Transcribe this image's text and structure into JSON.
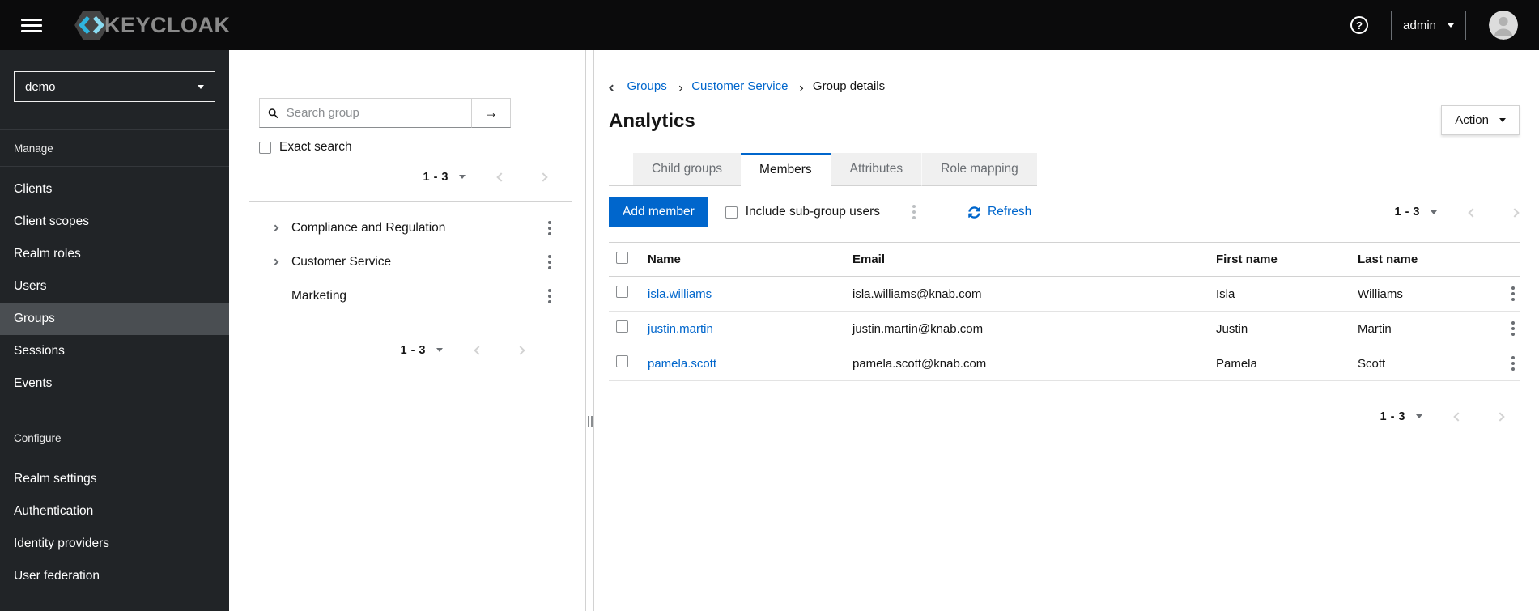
{
  "masthead": {
    "brand": "KEYCLOAK",
    "help_glyph": "?",
    "username": "admin"
  },
  "sidebar": {
    "realm": "demo",
    "manage": {
      "label": "Manage",
      "items": [
        "Clients",
        "Client scopes",
        "Realm roles",
        "Users",
        "Groups",
        "Sessions",
        "Events"
      ],
      "selected": "Groups"
    },
    "configure": {
      "label": "Configure",
      "items": [
        "Realm settings",
        "Authentication",
        "Identity providers",
        "User federation"
      ]
    }
  },
  "groups_panel": {
    "search_placeholder": "Search group",
    "search_submit_glyph": "→",
    "exact_search_label": "Exact search",
    "pagination_top": "1 - 3",
    "pagination_bottom": "1 - 3",
    "tree": [
      {
        "label": "Compliance and Regulation",
        "expandable": true
      },
      {
        "label": "Customer Service",
        "expandable": true
      },
      {
        "label": "Marketing",
        "expandable": false
      }
    ]
  },
  "main": {
    "breadcrumb": [
      "Groups",
      "Customer Service",
      "Group details"
    ],
    "title": "Analytics",
    "action_label": "Action",
    "tabs": [
      "Child groups",
      "Members",
      "Attributes",
      "Role mapping"
    ],
    "active_tab": "Members",
    "toolbar": {
      "add_member_label": "Add member",
      "include_subgroups_label": "Include sub-group users",
      "refresh_label": "Refresh",
      "pagination": "1 - 3"
    },
    "table": {
      "columns": [
        "Name",
        "Email",
        "First name",
        "Last name"
      ],
      "rows": [
        {
          "name": "isla.williams",
          "email": "isla.williams@knab.com",
          "first_name": "Isla",
          "last_name": "Williams"
        },
        {
          "name": "justin.martin",
          "email": "justin.martin@knab.com",
          "first_name": "Justin",
          "last_name": "Martin"
        },
        {
          "name": "pamela.scott",
          "email": "pamela.scott@knab.com",
          "first_name": "Pamela",
          "last_name": "Scott"
        }
      ]
    },
    "pagination_bottom": "1 - 3"
  },
  "colors": {
    "accent_blue": "#0066cc",
    "brand_cyan": "#36b9e5",
    "masthead_bg": "#0b0b0c",
    "sidebar_bg": "#212427",
    "sidebar_selected_bg": "#4a4e52",
    "border_gray": "#d2d2d2",
    "text_dark": "#151515",
    "text_muted": "#6a6e73"
  }
}
